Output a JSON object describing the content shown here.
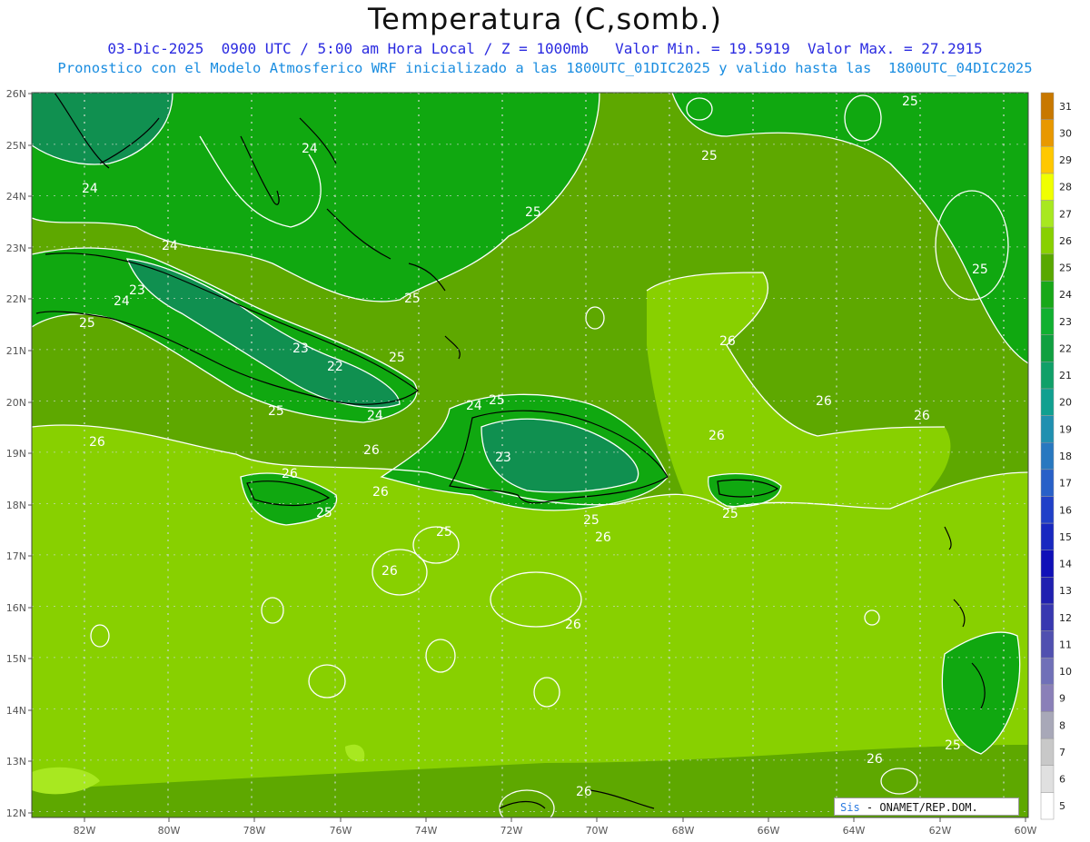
{
  "header": {
    "title": "Temperatura (C,somb.)",
    "line1": "03-Dic-2025  0900 UTC / 5:00 am Hora Local / Z = 1000mb   Valor Min. = 19.5919  Valor Max. = 27.2915",
    "line2": "Pronostico con el Modelo Atmosferico WRF inicializado a las 1800UTC_01DIC2025 y valido hasta las  1800UTC_04DIC2025"
  },
  "axes": {
    "lat_labels": [
      "26N",
      "25N",
      "24N",
      "23N",
      "22N",
      "21N",
      "20N",
      "19N",
      "18N",
      "17N",
      "16N",
      "15N",
      "14N",
      "13N",
      "12N"
    ],
    "lon_labels": [
      "82W",
      "80W",
      "78W",
      "76W",
      "74W",
      "72W",
      "70W",
      "68W",
      "66W",
      "64W",
      "62W",
      "60W"
    ]
  },
  "colorbar": {
    "levels": [
      "5",
      "6",
      "7",
      "8",
      "9",
      "10",
      "11",
      "12",
      "13",
      "14",
      "15",
      "16",
      "17",
      "18",
      "19",
      "20",
      "21",
      "22",
      "23",
      "24",
      "25",
      "26",
      "27",
      "28",
      "29",
      "30",
      "31"
    ],
    "colors": [
      "#ffffff",
      "#e0e0e0",
      "#c8c8c8",
      "#a8a8b8",
      "#8a80b8",
      "#7070b8",
      "#5050b0",
      "#3838b0",
      "#2020b0",
      "#1010b8",
      "#1828c0",
      "#2040c8",
      "#2860c8",
      "#2878c0",
      "#2090b0",
      "#10a090",
      "#10a068",
      "#10a040",
      "#10b030",
      "#18a818",
      "#58a800",
      "#88d000",
      "#a8e820",
      "#f0ff00",
      "#ffc800",
      "#e89800",
      "#c87800"
    ]
  },
  "contour_labels": [
    "24",
    "24",
    "24",
    "24",
    "23",
    "22",
    "25",
    "25",
    "25",
    "25",
    "25",
    "25",
    "26",
    "26",
    "26",
    "26",
    "26",
    "26",
    "26",
    "26",
    "26",
    "25",
    "25",
    "25",
    "24",
    "25",
    "25",
    "23",
    "23",
    "24",
    "26",
    "26",
    "26",
    "25",
    "25",
    "26",
    "25"
  ],
  "credit": {
    "prefix": "Sis",
    "text": "- ONAMET/REP.DOM."
  }
}
